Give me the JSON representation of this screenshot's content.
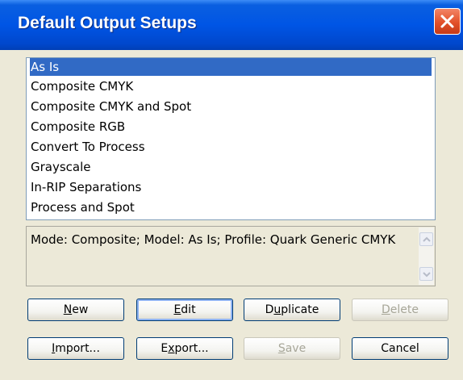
{
  "window": {
    "title": "Default Output Setups",
    "close_icon": "close-icon"
  },
  "setups_list": {
    "items": [
      {
        "label": "As Is",
        "selected": true
      },
      {
        "label": "Composite CMYK",
        "selected": false
      },
      {
        "label": "Composite CMYK and Spot",
        "selected": false
      },
      {
        "label": "Composite RGB",
        "selected": false
      },
      {
        "label": "Convert To Process",
        "selected": false
      },
      {
        "label": "Grayscale",
        "selected": false
      },
      {
        "label": "In-RIP Separations",
        "selected": false
      },
      {
        "label": "Process and Spot",
        "selected": false
      }
    ]
  },
  "description": {
    "text": "Mode: Composite; Model: As Is; Profile: Quark Generic CMYK"
  },
  "buttons": {
    "new": {
      "pre": "",
      "key": "N",
      "post": "ew",
      "enabled": true
    },
    "edit": {
      "pre": "",
      "key": "E",
      "post": "dit",
      "enabled": true
    },
    "duplicate": {
      "pre": "D",
      "key": "u",
      "post": "plicate",
      "enabled": true
    },
    "delete": {
      "pre": "",
      "key": "D",
      "post": "elete",
      "enabled": false
    },
    "import": {
      "pre": "",
      "key": "I",
      "post": "mport...",
      "enabled": true
    },
    "export": {
      "pre": "E",
      "key": "x",
      "post": "port...",
      "enabled": true
    },
    "save": {
      "pre": "",
      "key": "S",
      "post": "ave",
      "enabled": false
    },
    "cancel": {
      "pre": "",
      "key": "",
      "post": "Cancel",
      "enabled": true
    }
  },
  "colors": {
    "titlebar": "#0055e5",
    "selection": "#316ac5",
    "dialog_bg": "#ece9d8",
    "close_button": "#e2502a"
  }
}
